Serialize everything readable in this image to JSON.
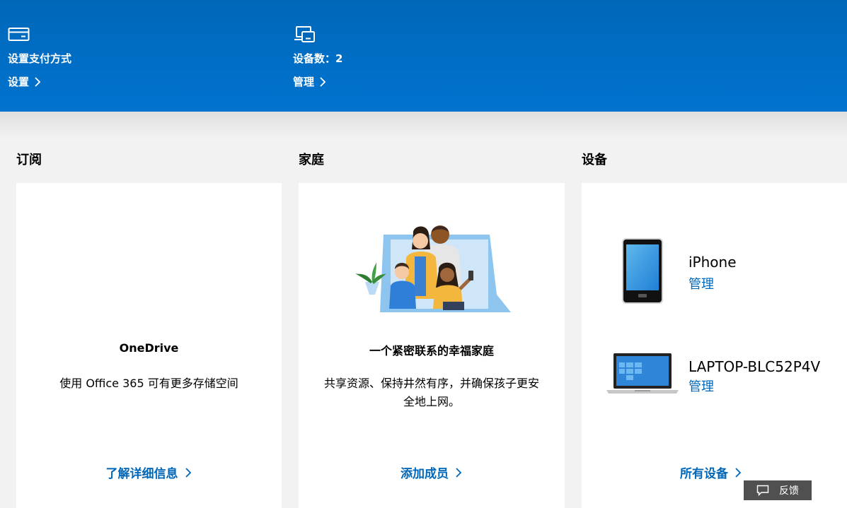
{
  "banner": {
    "payment": {
      "icon": "credit-card-icon",
      "title": "设置支付方式",
      "link": "设置"
    },
    "devices": {
      "icon": "devices-icon",
      "title": "设备数：2",
      "link": "管理"
    }
  },
  "sections": {
    "subscriptions": {
      "heading": "订阅",
      "card_title": "OneDrive",
      "card_desc": "使用 Office 365 可有更多存储空间",
      "link": "了解详细信息"
    },
    "family": {
      "heading": "家庭",
      "illustration": "family-illustration",
      "card_title": "一个紧密联系的幸福家庭",
      "card_desc": "共享资源、保持井然有序，并确保孩子更安全地上网。",
      "link": "添加成员"
    },
    "devices": {
      "heading": "设备",
      "items": [
        {
          "icon": "phone-icon",
          "name": "iPhone",
          "action": "管理"
        },
        {
          "icon": "laptop-icon",
          "name": "LAPTOP-BLC52P4V",
          "action": "管理"
        }
      ],
      "link": "所有设备"
    }
  },
  "feedback": {
    "icon": "comment-icon",
    "label": "反馈"
  },
  "colors": {
    "banner": "#0067b8",
    "link": "#0067b8",
    "background": "#f2f2f2",
    "feedback": "#505050"
  }
}
